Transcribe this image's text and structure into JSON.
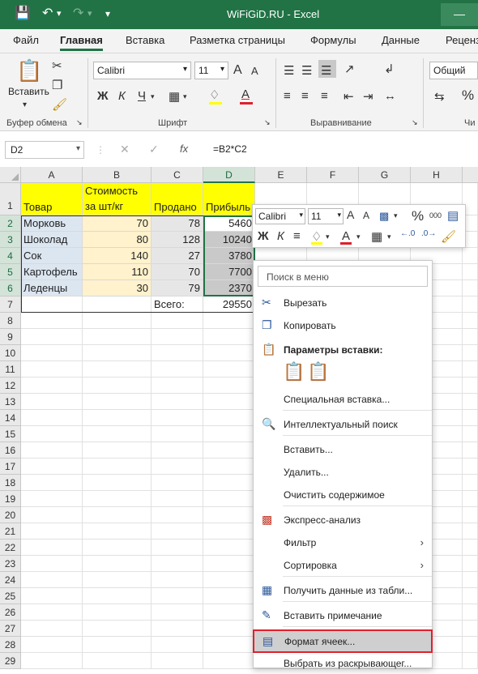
{
  "title": "WiFiGiD.RU  -  Excel",
  "menu": [
    "Файл",
    "Главная",
    "Вставка",
    "Разметка страницы",
    "Формулы",
    "Данные",
    "Реценз"
  ],
  "ribbon": {
    "paste_label": "Вставить",
    "font_name": "Calibri",
    "font_size": "11",
    "number_format": "Общий",
    "groups": [
      "Буфер обмена",
      "Шрифт",
      "Выравнивание",
      "Чи"
    ],
    "bold": "Ж",
    "italic": "К",
    "underline": "Ч",
    "grow": "A",
    "shrink": "A",
    "font_color": "A"
  },
  "formula_bar": {
    "name_box": "D2",
    "fx": "fx",
    "formula": "=B2*C2"
  },
  "columns": [
    "A",
    "B",
    "C",
    "D",
    "E",
    "F",
    "G",
    "H"
  ],
  "rows": [
    "1",
    "2",
    "3",
    "4",
    "5",
    "6",
    "7",
    "8",
    "9",
    "10",
    "11",
    "12",
    "13",
    "14",
    "15",
    "16",
    "17",
    "18",
    "19",
    "20",
    "21",
    "22",
    "23",
    "24",
    "25",
    "26",
    "27",
    "28",
    "29"
  ],
  "table": {
    "h1": "Товар",
    "h2a": "Стоимость",
    "h2b": "за шт/кг",
    "h3": "Продано",
    "h4": "Прибыль",
    "rows": [
      {
        "a": "Морковь",
        "b": "70",
        "c": "78",
        "d": "5460"
      },
      {
        "a": "Шоколад",
        "b": "80",
        "c": "128",
        "d": "10240"
      },
      {
        "a": "Сок",
        "b": "140",
        "c": "27",
        "d": "3780"
      },
      {
        "a": "Картофель",
        "b": "110",
        "c": "70",
        "d": "7700"
      },
      {
        "a": "Леденцы",
        "b": "30",
        "c": "79",
        "d": "2370"
      }
    ],
    "total_label": "Всего:",
    "total_value": "29550"
  },
  "minibar": {
    "font": "Calibri",
    "size": "11",
    "percent": "%",
    "thousands": "000",
    "bold": "Ж",
    "italic": "К"
  },
  "context_menu": {
    "search_placeholder": "Поиск в меню",
    "items": [
      "Вырезать",
      "Копировать",
      "Параметры вставки:",
      "Специальная вставка...",
      "Интеллектуальный поиск",
      "Вставить...",
      "Удалить...",
      "Очистить содержимое",
      "Экспресс-анализ",
      "Фильтр",
      "Сортировка",
      "Получить данные из табли...",
      "Вставить примечание",
      "Формат ячеек...",
      "Выбрать из раскрывающег..."
    ]
  },
  "colors": {
    "accent": "#217346",
    "header_yellow": "#ffff00",
    "col_a": "#dce6f1",
    "col_b": "#fff2cc",
    "col_c": "#e7e6e6",
    "col_d": "#c9c9c9",
    "highlight": "#e0202c"
  }
}
